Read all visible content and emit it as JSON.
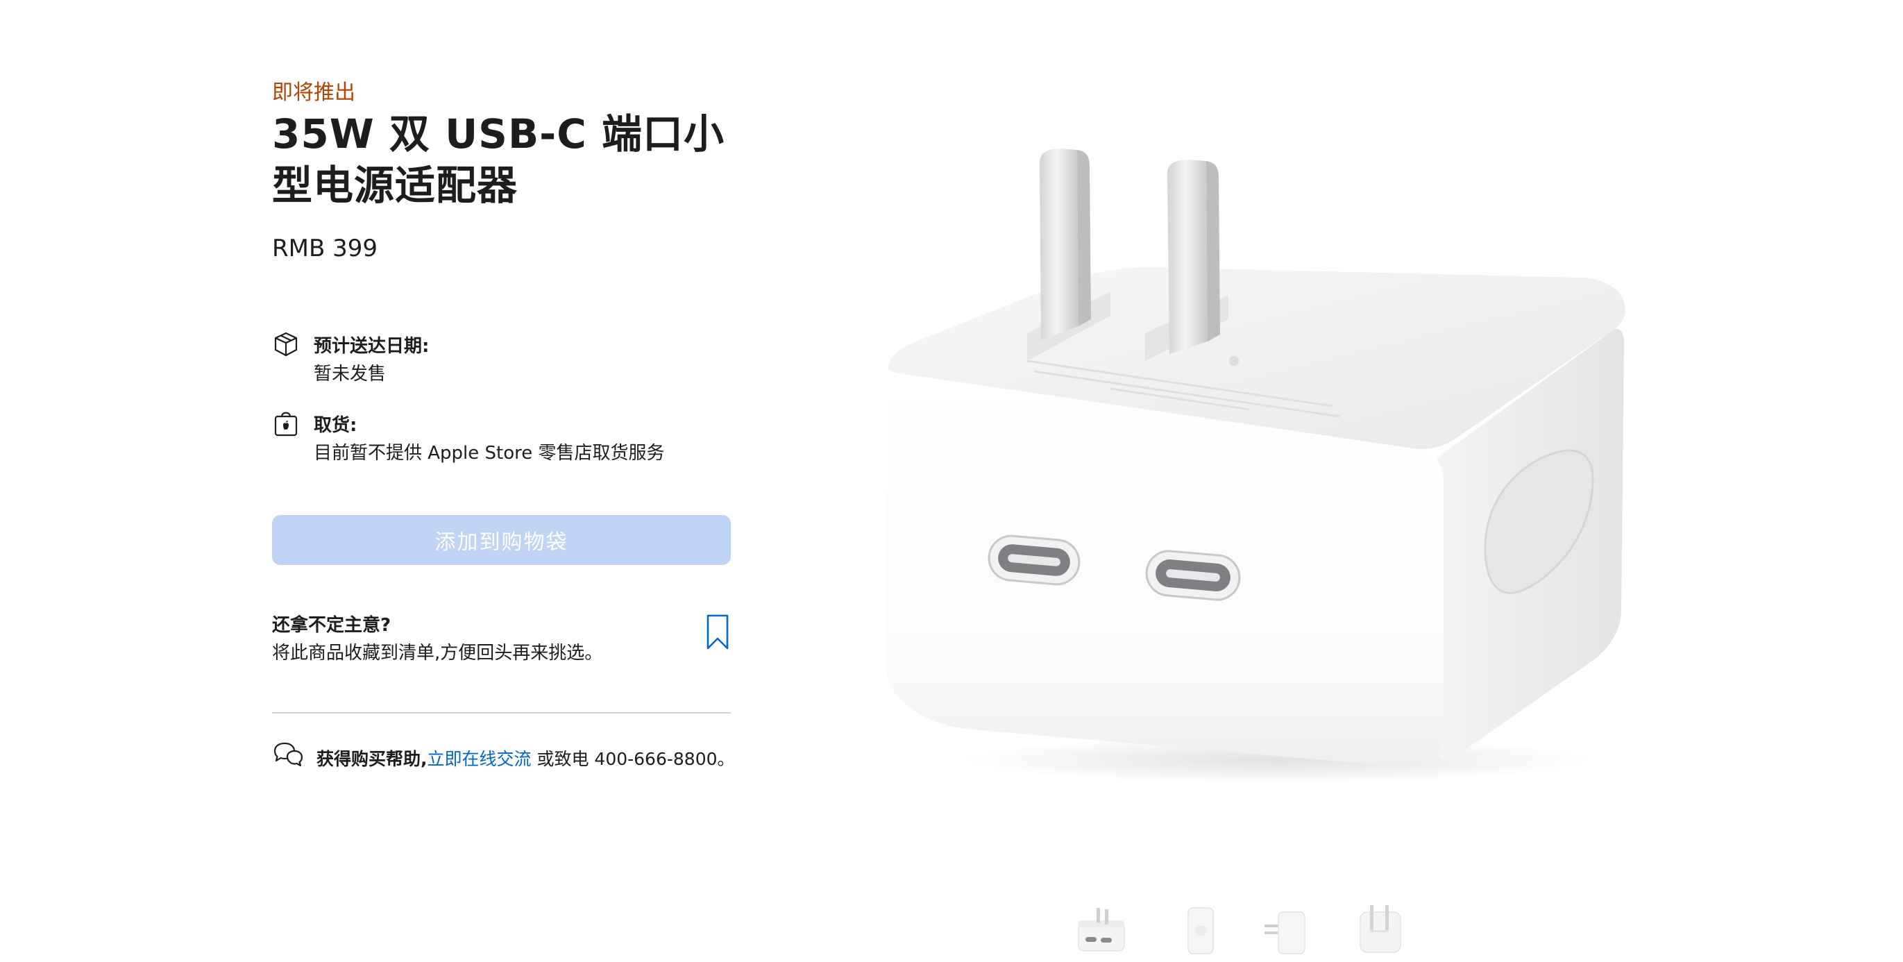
{
  "product": {
    "eyebrow": "即将推出",
    "title": "35W 双 USB-C 端口小型电源适配器",
    "price": "RMB 399"
  },
  "delivery": {
    "label": "预计送达日期:",
    "value": "暂未发售"
  },
  "pickup": {
    "label": "取货:",
    "value": "目前暂不提供 Apple Store 零售店取货服务"
  },
  "cart": {
    "add_label": "添加到购物袋"
  },
  "save": {
    "title": "还拿不定主意?",
    "description": "将此商品收藏到清单,方便回头再来挑选。"
  },
  "help": {
    "lead": "获得购买帮助,",
    "link": "立即在线交流",
    "phone": " 或致电 400-666-8800。"
  },
  "colors": {
    "eyebrow": "#b64400",
    "link": "#0066cc",
    "button_disabled": "#bfd4f4"
  },
  "gallery": {
    "thumbnail_count": 4,
    "selected_index": 0
  }
}
